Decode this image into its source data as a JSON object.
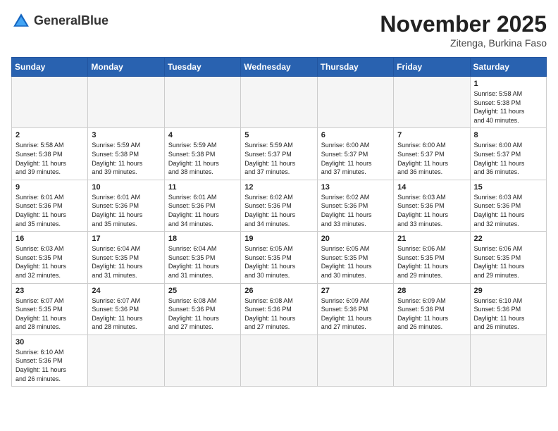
{
  "header": {
    "logo_text_normal": "General",
    "logo_text_bold": "Blue",
    "month_title": "November 2025",
    "location": "Zitenga, Burkina Faso"
  },
  "calendar": {
    "days_of_week": [
      "Sunday",
      "Monday",
      "Tuesday",
      "Wednesday",
      "Thursday",
      "Friday",
      "Saturday"
    ],
    "weeks": [
      [
        {
          "day": "",
          "info": ""
        },
        {
          "day": "",
          "info": ""
        },
        {
          "day": "",
          "info": ""
        },
        {
          "day": "",
          "info": ""
        },
        {
          "day": "",
          "info": ""
        },
        {
          "day": "",
          "info": ""
        },
        {
          "day": "1",
          "info": "Sunrise: 5:58 AM\nSunset: 5:38 PM\nDaylight: 11 hours\nand 40 minutes."
        }
      ],
      [
        {
          "day": "2",
          "info": "Sunrise: 5:58 AM\nSunset: 5:38 PM\nDaylight: 11 hours\nand 39 minutes."
        },
        {
          "day": "3",
          "info": "Sunrise: 5:59 AM\nSunset: 5:38 PM\nDaylight: 11 hours\nand 39 minutes."
        },
        {
          "day": "4",
          "info": "Sunrise: 5:59 AM\nSunset: 5:38 PM\nDaylight: 11 hours\nand 38 minutes."
        },
        {
          "day": "5",
          "info": "Sunrise: 5:59 AM\nSunset: 5:37 PM\nDaylight: 11 hours\nand 37 minutes."
        },
        {
          "day": "6",
          "info": "Sunrise: 6:00 AM\nSunset: 5:37 PM\nDaylight: 11 hours\nand 37 minutes."
        },
        {
          "day": "7",
          "info": "Sunrise: 6:00 AM\nSunset: 5:37 PM\nDaylight: 11 hours\nand 36 minutes."
        },
        {
          "day": "8",
          "info": "Sunrise: 6:00 AM\nSunset: 5:37 PM\nDaylight: 11 hours\nand 36 minutes."
        }
      ],
      [
        {
          "day": "9",
          "info": "Sunrise: 6:01 AM\nSunset: 5:36 PM\nDaylight: 11 hours\nand 35 minutes."
        },
        {
          "day": "10",
          "info": "Sunrise: 6:01 AM\nSunset: 5:36 PM\nDaylight: 11 hours\nand 35 minutes."
        },
        {
          "day": "11",
          "info": "Sunrise: 6:01 AM\nSunset: 5:36 PM\nDaylight: 11 hours\nand 34 minutes."
        },
        {
          "day": "12",
          "info": "Sunrise: 6:02 AM\nSunset: 5:36 PM\nDaylight: 11 hours\nand 34 minutes."
        },
        {
          "day": "13",
          "info": "Sunrise: 6:02 AM\nSunset: 5:36 PM\nDaylight: 11 hours\nand 33 minutes."
        },
        {
          "day": "14",
          "info": "Sunrise: 6:03 AM\nSunset: 5:36 PM\nDaylight: 11 hours\nand 33 minutes."
        },
        {
          "day": "15",
          "info": "Sunrise: 6:03 AM\nSunset: 5:36 PM\nDaylight: 11 hours\nand 32 minutes."
        }
      ],
      [
        {
          "day": "16",
          "info": "Sunrise: 6:03 AM\nSunset: 5:35 PM\nDaylight: 11 hours\nand 32 minutes."
        },
        {
          "day": "17",
          "info": "Sunrise: 6:04 AM\nSunset: 5:35 PM\nDaylight: 11 hours\nand 31 minutes."
        },
        {
          "day": "18",
          "info": "Sunrise: 6:04 AM\nSunset: 5:35 PM\nDaylight: 11 hours\nand 31 minutes."
        },
        {
          "day": "19",
          "info": "Sunrise: 6:05 AM\nSunset: 5:35 PM\nDaylight: 11 hours\nand 30 minutes."
        },
        {
          "day": "20",
          "info": "Sunrise: 6:05 AM\nSunset: 5:35 PM\nDaylight: 11 hours\nand 30 minutes."
        },
        {
          "day": "21",
          "info": "Sunrise: 6:06 AM\nSunset: 5:35 PM\nDaylight: 11 hours\nand 29 minutes."
        },
        {
          "day": "22",
          "info": "Sunrise: 6:06 AM\nSunset: 5:35 PM\nDaylight: 11 hours\nand 29 minutes."
        }
      ],
      [
        {
          "day": "23",
          "info": "Sunrise: 6:07 AM\nSunset: 5:35 PM\nDaylight: 11 hours\nand 28 minutes."
        },
        {
          "day": "24",
          "info": "Sunrise: 6:07 AM\nSunset: 5:36 PM\nDaylight: 11 hours\nand 28 minutes."
        },
        {
          "day": "25",
          "info": "Sunrise: 6:08 AM\nSunset: 5:36 PM\nDaylight: 11 hours\nand 27 minutes."
        },
        {
          "day": "26",
          "info": "Sunrise: 6:08 AM\nSunset: 5:36 PM\nDaylight: 11 hours\nand 27 minutes."
        },
        {
          "day": "27",
          "info": "Sunrise: 6:09 AM\nSunset: 5:36 PM\nDaylight: 11 hours\nand 27 minutes."
        },
        {
          "day": "28",
          "info": "Sunrise: 6:09 AM\nSunset: 5:36 PM\nDaylight: 11 hours\nand 26 minutes."
        },
        {
          "day": "29",
          "info": "Sunrise: 6:10 AM\nSunset: 5:36 PM\nDaylight: 11 hours\nand 26 minutes."
        }
      ],
      [
        {
          "day": "30",
          "info": "Sunrise: 6:10 AM\nSunset: 5:36 PM\nDaylight: 11 hours\nand 26 minutes."
        },
        {
          "day": "",
          "info": ""
        },
        {
          "day": "",
          "info": ""
        },
        {
          "day": "",
          "info": ""
        },
        {
          "day": "",
          "info": ""
        },
        {
          "day": "",
          "info": ""
        },
        {
          "day": "",
          "info": ""
        }
      ]
    ]
  }
}
